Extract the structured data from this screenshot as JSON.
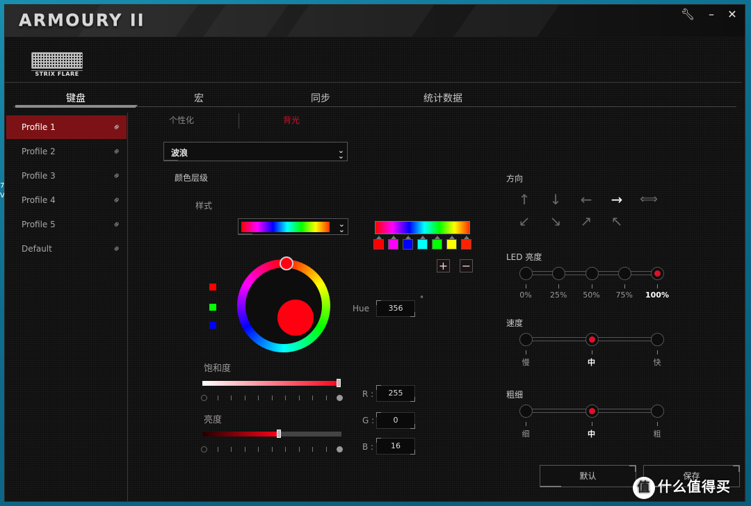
{
  "app": {
    "title": "ARMOURY II",
    "device_name": "STRIX FLARE",
    "controls": {
      "settings_icon": "wrench-icon",
      "minimize_icon": "minimize-icon",
      "close_icon": "close-icon"
    }
  },
  "main_tabs": [
    {
      "label": "键盘",
      "active": true
    },
    {
      "label": "宏",
      "active": false
    },
    {
      "label": "同步",
      "active": false
    },
    {
      "label": "统计数据",
      "active": false
    }
  ],
  "profiles": [
    {
      "label": "Profile 1",
      "active": true
    },
    {
      "label": "Profile 2",
      "active": false
    },
    {
      "label": "Profile 3",
      "active": false
    },
    {
      "label": "Profile 4",
      "active": false
    },
    {
      "label": "Profile 5",
      "active": false
    },
    {
      "label": "Default",
      "active": false
    }
  ],
  "sub_tabs": [
    {
      "label": "个性化",
      "active": false
    },
    {
      "label": "背光",
      "active": true
    }
  ],
  "effect": {
    "selected": "波浪"
  },
  "color_section": {
    "title": "颜色层级",
    "style_label": "样式",
    "gradient_stops": [
      "#ff0000",
      "#ff00ff",
      "#0000ff",
      "#00ffff",
      "#00ff00",
      "#ffff00",
      "#ff2200"
    ],
    "add_label": "+",
    "remove_label": "−"
  },
  "color_picker": {
    "hue_label": "Hue",
    "hue": "356",
    "hue_unit": "°",
    "current_color": "#ff0010",
    "saturation_label": "饱和度",
    "saturation": 1.0,
    "brightness_label": "亮度",
    "brightness": 0.55,
    "r_label": "R :",
    "g_label": "G :",
    "b_label": "B :",
    "r": "255",
    "g": "0",
    "b": "16"
  },
  "direction": {
    "title": "方向",
    "options": [
      {
        "name": "up",
        "glyph": "↑",
        "active": false
      },
      {
        "name": "down",
        "glyph": "↓",
        "active": false
      },
      {
        "name": "left",
        "glyph": "←",
        "active": false
      },
      {
        "name": "right",
        "glyph": "→",
        "active": true
      },
      {
        "name": "left-right",
        "glyph": "⟺",
        "active": false
      },
      {
        "name": "down-left",
        "glyph": "↙",
        "active": false
      },
      {
        "name": "down-right",
        "glyph": "↘",
        "active": false
      },
      {
        "name": "up-right",
        "glyph": "↗",
        "active": false
      },
      {
        "name": "up-left",
        "glyph": "↖",
        "active": false
      }
    ]
  },
  "led_brightness": {
    "title": "LED 亮度",
    "levels": [
      "0%",
      "25%",
      "50%",
      "75%",
      "100%"
    ],
    "selected_index": 4
  },
  "speed": {
    "title": "速度",
    "levels": [
      "慢",
      "中",
      "快"
    ],
    "selected_index": 1
  },
  "thickness": {
    "title": "粗细",
    "levels": [
      "细",
      "中",
      "粗"
    ],
    "selected_index": 1
  },
  "footer": {
    "default_label": "默认",
    "save_label": "保存"
  },
  "watermark": {
    "badge": "值",
    "text": "什么值得买"
  }
}
